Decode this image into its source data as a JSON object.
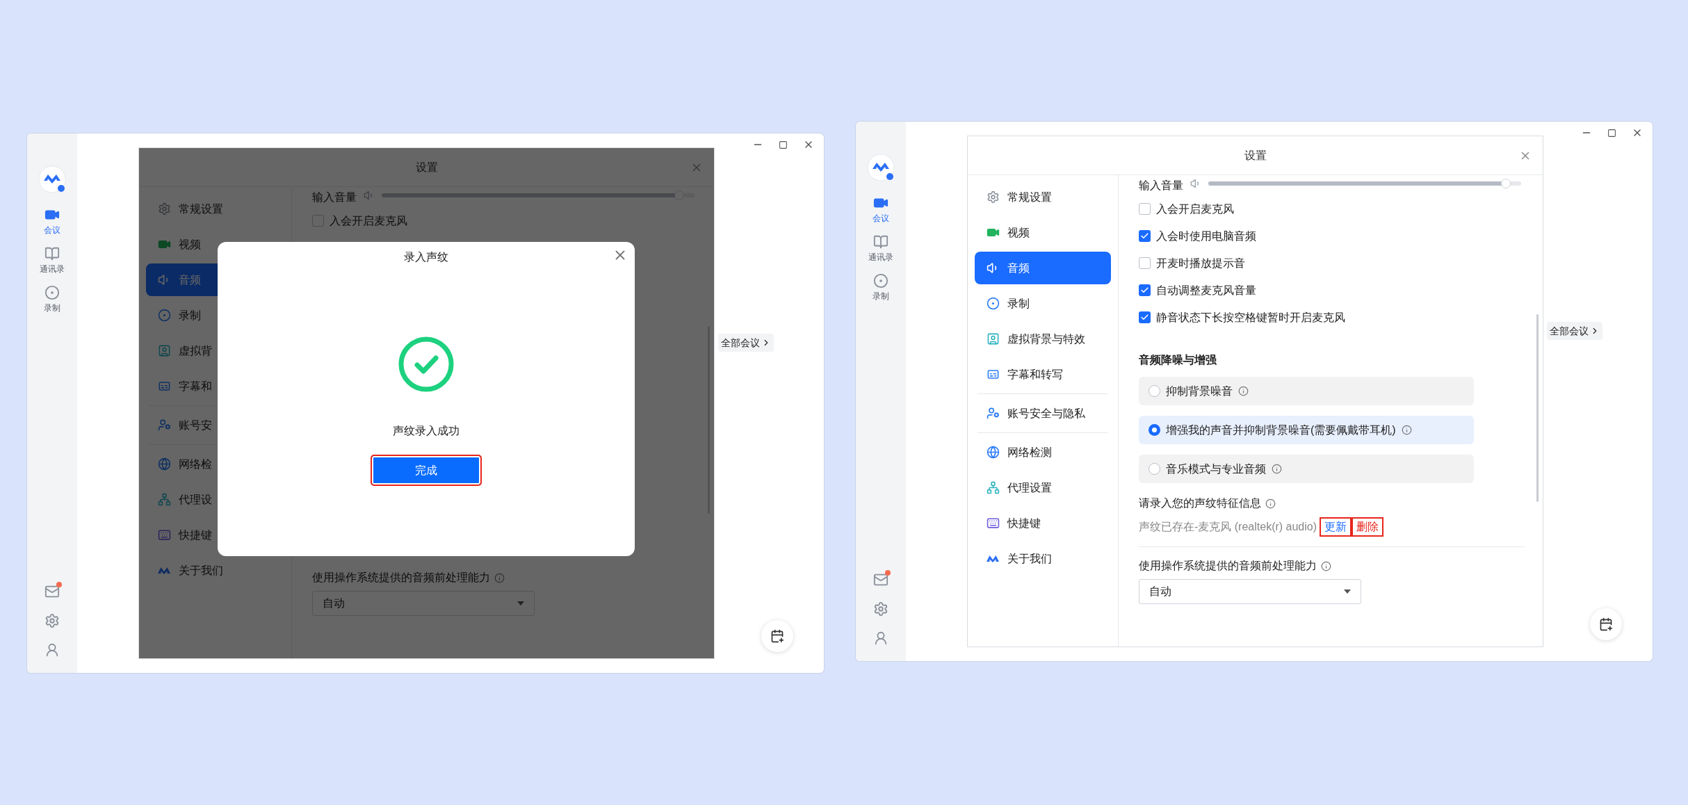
{
  "windows": [
    {
      "rail": {
        "items": [
          {
            "label": "会议",
            "selected": true
          },
          {
            "label": "通讯录",
            "selected": false
          },
          {
            "label": "录制",
            "selected": false
          }
        ],
        "mail_unread": true
      },
      "all_meetings": "全部会议",
      "settings": {
        "title": "设置",
        "dimmed": true,
        "nav": [
          {
            "label": "常规设置",
            "selected": false
          },
          {
            "label": "视频",
            "selected": false
          },
          {
            "label": "音频",
            "selected": true
          },
          {
            "label": "录制",
            "selected": false
          },
          {
            "label": "虚拟背",
            "selected": false
          },
          {
            "label": "字幕和",
            "selected": false
          },
          {
            "label": "账号安",
            "selected": false
          },
          {
            "label": "网络检",
            "selected": false
          },
          {
            "label": "代理设",
            "selected": false
          },
          {
            "label": "快捷键",
            "selected": false
          },
          {
            "label": "关于我们",
            "selected": false
          }
        ],
        "volume": {
          "label": "输入音量",
          "level": 0.95
        },
        "checkboxes": [
          {
            "label": "入会开启麦克风",
            "checked": false
          }
        ],
        "preprocess": {
          "label": "使用操作系统提供的音频前处理能力",
          "value": "自动"
        }
      },
      "dialog": {
        "title": "录入声纹",
        "message": "声纹录入成功",
        "button": "完成"
      }
    },
    {
      "rail": {
        "items": [
          {
            "label": "会议",
            "selected": true
          },
          {
            "label": "通讯录",
            "selected": false
          },
          {
            "label": "录制",
            "selected": false
          }
        ],
        "mail_unread": true
      },
      "all_meetings": "全部会议",
      "settings": {
        "title": "设置",
        "dimmed": false,
        "nav": [
          {
            "label": "常规设置",
            "selected": false
          },
          {
            "label": "视频",
            "selected": false
          },
          {
            "label": "音频",
            "selected": true
          },
          {
            "label": "录制",
            "selected": false
          },
          {
            "label": "虚拟背景与特效",
            "selected": false
          },
          {
            "label": "字幕和转写",
            "selected": false
          },
          {
            "label": "账号安全与隐私",
            "selected": false
          },
          {
            "label": "网络检测",
            "selected": false
          },
          {
            "label": "代理设置",
            "selected": false
          },
          {
            "label": "快捷键",
            "selected": false
          },
          {
            "label": "关于我们",
            "selected": false
          }
        ],
        "volume": {
          "label": "输入音量",
          "level": 0.95
        },
        "checkboxes": [
          {
            "label": "入会开启麦克风",
            "checked": false
          },
          {
            "label": "入会时使用电脑音频",
            "checked": true
          },
          {
            "label": "开麦时播放提示音",
            "checked": false
          },
          {
            "label": "自动调整麦克风音量",
            "checked": true
          },
          {
            "label": "静音状态下长按空格键暂时开启麦克风",
            "checked": true
          }
        ],
        "noise": {
          "title": "音频降噪与增强",
          "options": [
            {
              "label": "抑制背景噪音",
              "selected": false
            },
            {
              "label": "增强我的声音并抑制背景噪音(需要佩戴带耳机)",
              "selected": true
            },
            {
              "label": "音乐模式与专业音频",
              "selected": false
            }
          ]
        },
        "voiceprint": {
          "label": "请录入您的声纹特征信息",
          "status": "声纹已存在-麦克风 (realtek(r) audio)",
          "update": "更新",
          "delete": "删除"
        },
        "preprocess": {
          "label": "使用操作系统提供的音频前处理能力",
          "value": "自动"
        }
      }
    }
  ]
}
